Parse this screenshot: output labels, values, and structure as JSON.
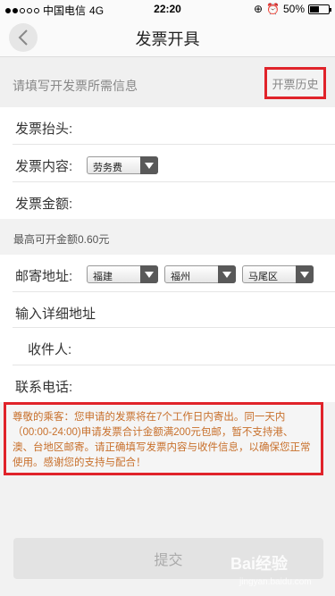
{
  "status": {
    "carrier": "中国电信",
    "network": "4G",
    "time": "22:20",
    "battery": "50%",
    "battery_level": 0.5
  },
  "nav": {
    "title": "发票开具"
  },
  "hint": {
    "text": "请填写开发票所需信息",
    "history_label": "开票历史"
  },
  "form": {
    "title_label": "发票抬头:",
    "content_label": "发票内容:",
    "content_value": "劳务费",
    "amount_label": "发票金额:",
    "max_amount": "最高可开金额0.60元",
    "address_label": "邮寄地址:",
    "province": "福建",
    "city": "福州",
    "district": "马尾区",
    "detail_placeholder": "输入详细地址",
    "recipient_label": "收件人:",
    "phone_label": "联系电话:"
  },
  "notice": {
    "text": "尊敬的乘客：您申请的发票将在7个工作日内寄出。同一天内（00:00-24:00)申请发票合计金额满200元包邮，暂不支持港、澳、台地区邮寄。请正确填写发票内容与收件信息，以确保您正常使用。感谢您的支持与配合！"
  },
  "submit": {
    "label": "提交"
  },
  "watermark": {
    "text": "Bai经验",
    "sub": "jingyan.baidu.com"
  },
  "colors": {
    "highlight": "#e0232a",
    "notice_text": "#c8702c"
  }
}
